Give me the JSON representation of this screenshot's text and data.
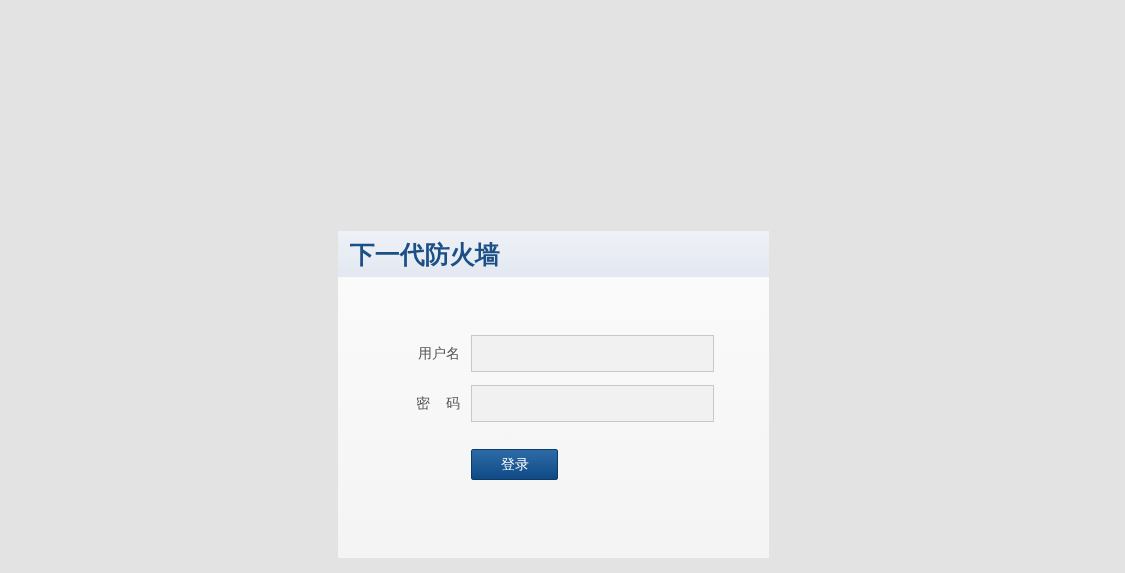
{
  "login_card": {
    "title": "下一代防火墙",
    "fields": [
      {
        "label": "用户名"
      },
      {
        "label": "密 码"
      }
    ],
    "button": "登录"
  }
}
